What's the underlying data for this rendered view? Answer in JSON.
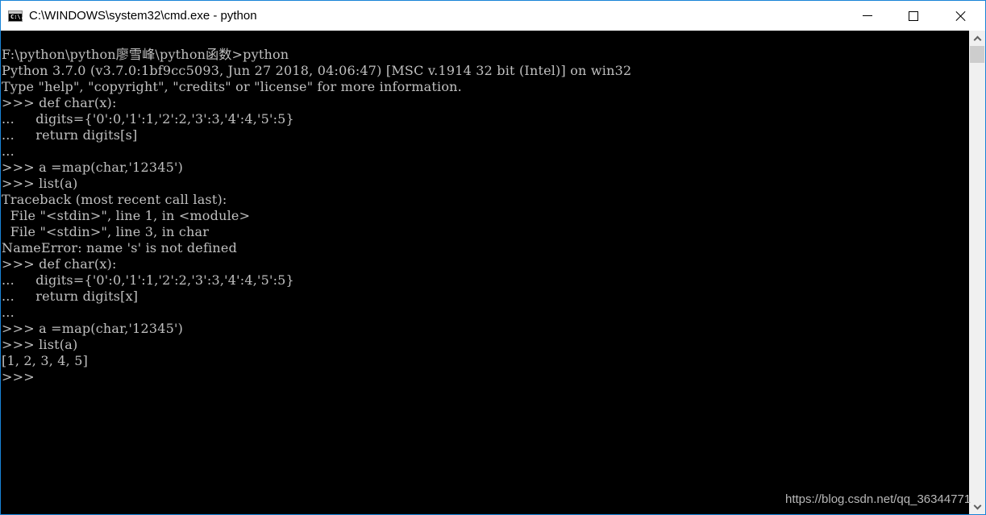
{
  "window": {
    "title": "C:\\WINDOWS\\system32\\cmd.exe - python",
    "app_icon": "cmd-icon",
    "app_icon_text": "C:\\.",
    "caption_buttons": {
      "minimize": "minimize-icon",
      "maximize": "maximize-icon",
      "close": "close-icon"
    },
    "border_color": "#1883d7"
  },
  "console": {
    "background": "#000000",
    "foreground": "#c0c0c0",
    "lines": [
      "F:\\python\\python廖雪峰\\python函数>python",
      "Python 3.7.0 (v3.7.0:1bf9cc5093, Jun 27 2018, 04:06:47) [MSC v.1914 32 bit (Intel)] on win32",
      "Type \"help\", \"copyright\", \"credits\" or \"license\" for more information.",
      ">>> def char(x):",
      "...     digits={'0':0,'1':1,'2':2,'3':3,'4':4,'5':5}",
      "...     return digits[s]",
      "...",
      ">>> a =map(char,'12345')",
      ">>> list(a)",
      "Traceback (most recent call last):",
      "  File \"<stdin>\", line 1, in <module>",
      "  File \"<stdin>\", line 3, in char",
      "NameError: name 's' is not defined",
      ">>> def char(x):",
      "...     digits={'0':0,'1':1,'2':2,'3':3,'4':4,'5':5}",
      "...     return digits[x]",
      "...",
      ">>> a =map(char,'12345')",
      ">>> list(a)",
      "[1, 2, 3, 4, 5]",
      ">>>"
    ]
  },
  "scrollbar": {
    "up_icon": "chevron-up-icon",
    "down_icon": "chevron-down-icon"
  },
  "watermark": "https://blog.csdn.net/qq_36344771"
}
